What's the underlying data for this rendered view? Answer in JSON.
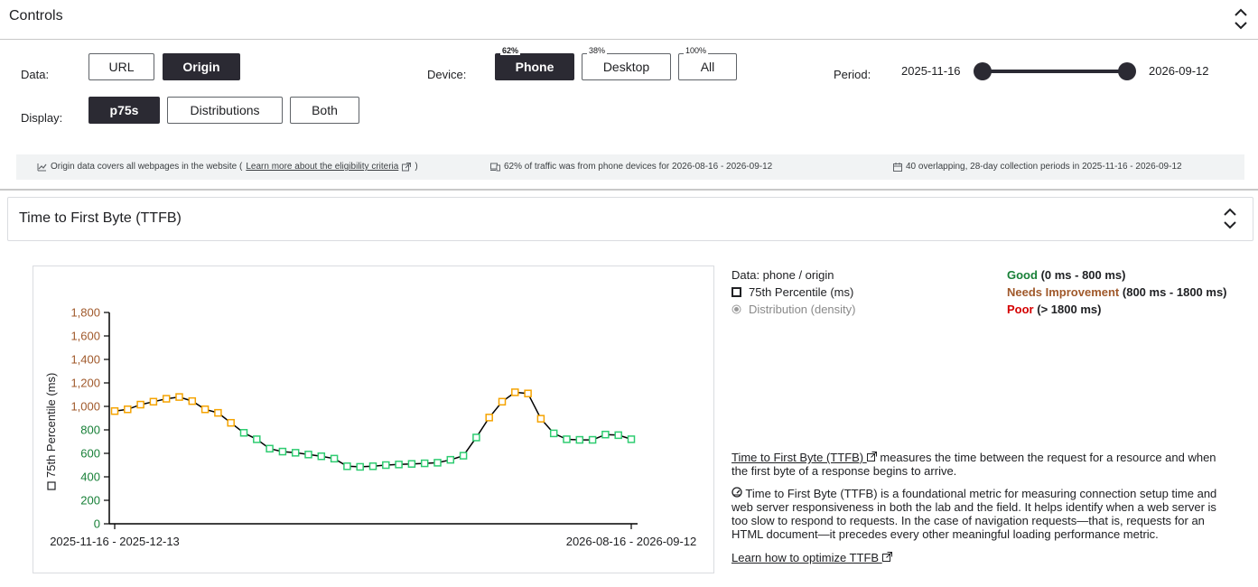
{
  "controls": {
    "title": "Controls",
    "data_label": "Data:",
    "data_options": [
      {
        "label": "URL",
        "active": false
      },
      {
        "label": "Origin",
        "active": true
      }
    ],
    "display_label": "Display:",
    "display_options": [
      {
        "label": "p75s",
        "active": true
      },
      {
        "label": "Distributions",
        "active": false
      },
      {
        "label": "Both",
        "active": false
      }
    ],
    "device_label": "Device:",
    "device_options": [
      {
        "label": "Phone",
        "pct": "62%",
        "active": true
      },
      {
        "label": "Desktop",
        "pct": "38%",
        "active": false
      },
      {
        "label": "All",
        "pct": "100%",
        "active": false
      }
    ],
    "period_label": "Period:",
    "period_start": "2025-11-16",
    "period_end": "2026-09-12"
  },
  "info_bar": {
    "origin_prefix": "Origin data covers all webpages in the website (",
    "origin_link": "Learn more about the eligibility criteria",
    "origin_suffix": ")",
    "traffic": "62% of traffic was from phone devices for 2026-08-16 - 2026-09-12",
    "periods": "40 overlapping, 28-day collection periods in 2025-11-16 - 2026-09-12"
  },
  "metric": {
    "title": "Time to First Byte (TTFB)",
    "data_desc": "Data: phone / origin",
    "legend_p75": "75th Percentile (ms)",
    "legend_dist": "Distribution (density)",
    "good_label": "Good",
    "good_range": "(0 ms - 800 ms)",
    "ni_label": "Needs Improvement",
    "ni_range": "(800 ms - 1800 ms)",
    "poor_label": "Poor",
    "poor_range": "(> 1800 ms)",
    "desc_link": "Time to First Byte (TTFB)",
    "desc_rest": " measures the time between the request for a resource and when the first byte of a response begins to arrive.",
    "desc2": "Time to First Byte (TTFB) is a foundational metric for measuring connection setup time and web server responsiveness in both the lab and the field. It helps identify when a web server is too slow to respond to requests. In the case of navigation requests—that is, requests for an HTML document—it precedes every other meaningful loading performance metric.",
    "learn_link": "Learn how to optimize TTFB"
  },
  "colors": {
    "good": "#188038",
    "needs_improvement": "#a0592b",
    "poor": "#d40000",
    "good_marker": "#2ecc71",
    "ni_marker": "#f5a300",
    "active_button": "#2b2a33"
  },
  "chart_data": {
    "type": "line",
    "ylabel": "75th Percentile (ms)",
    "ylim": [
      0,
      1800
    ],
    "yticks": [
      "0",
      "200",
      "400",
      "600",
      "800",
      "1,000",
      "1,200",
      "1,400",
      "1,600",
      "1,800"
    ],
    "xtick_labels": [
      "2025-11-16 - 2025-12-13",
      "2026-08-16 - 2026-09-12"
    ],
    "grid": false,
    "series": [
      {
        "name": "75th Percentile (ms)",
        "values": [
          960,
          975,
          1015,
          1040,
          1065,
          1080,
          1045,
          975,
          945,
          860,
          775,
          720,
          640,
          615,
          605,
          590,
          575,
          555,
          490,
          485,
          490,
          500,
          505,
          510,
          515,
          520,
          545,
          580,
          735,
          905,
          1040,
          1120,
          1110,
          895,
          770,
          720,
          715,
          715,
          760,
          755,
          720
        ]
      }
    ]
  }
}
